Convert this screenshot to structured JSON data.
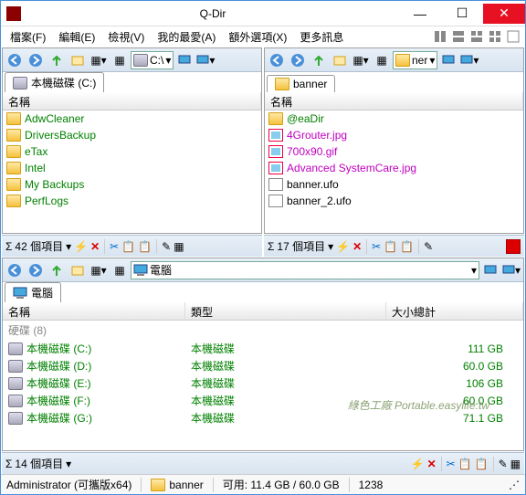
{
  "title": "Q-Dir",
  "menu": [
    "檔案(F)",
    "編輯(E)",
    "檢視(V)",
    "我的最愛(A)",
    "額外選項(X)",
    "更多訊息"
  ],
  "paneL": {
    "tab": "本機磁碟 (C:)",
    "addr": "C:\\",
    "col": "名稱",
    "items": [
      {
        "n": "AdwCleaner",
        "t": "folder"
      },
      {
        "n": "DriversBackup",
        "t": "folder"
      },
      {
        "n": "eTax",
        "t": "folder"
      },
      {
        "n": "Intel",
        "t": "folder"
      },
      {
        "n": "My Backups",
        "t": "folder"
      },
      {
        "n": "PerfLogs",
        "t": "folder"
      }
    ],
    "count": "42 個項目"
  },
  "paneR": {
    "tab": "banner",
    "addr": "ner",
    "col": "名稱",
    "items": [
      {
        "n": "@eaDir",
        "t": "folder",
        "c": "green"
      },
      {
        "n": "4Grouter.jpg",
        "t": "img",
        "c": "magenta"
      },
      {
        "n": "700x90.gif",
        "t": "img",
        "c": "magenta"
      },
      {
        "n": "Advanced SystemCare.jpg",
        "t": "img",
        "c": "magenta"
      },
      {
        "n": "banner.ufo",
        "t": "file",
        "c": "black"
      },
      {
        "n": "banner_2.ufo",
        "t": "file",
        "c": "black"
      }
    ],
    "count": "17 個項目"
  },
  "paneB": {
    "tab": "電腦",
    "addr": "電腦",
    "cols": [
      "名稱",
      "類型",
      "大小總計"
    ],
    "group": "硬碟 (8)",
    "drives": [
      {
        "n": "本機磁碟 (C:)",
        "t": "本機磁碟",
        "s": "111 GB"
      },
      {
        "n": "本機磁碟 (D:)",
        "t": "本機磁碟",
        "s": "60.0 GB"
      },
      {
        "n": "本機磁碟 (E:)",
        "t": "本機磁碟",
        "s": "106 GB"
      },
      {
        "n": "本機磁碟 (F:)",
        "t": "本機磁碟",
        "s": "60.0 GB"
      },
      {
        "n": "本機磁碟 (G:)",
        "t": "本機磁碟",
        "s": "71.1 GB"
      }
    ],
    "count": "14 個項目"
  },
  "status": {
    "user": "Administrator (可攜版x64)",
    "folder": "banner",
    "space": "可用: 11.4 GB / 60.0 GB",
    "num": "1238"
  },
  "watermark": "綠色工廠 Portable.easylife.tw"
}
